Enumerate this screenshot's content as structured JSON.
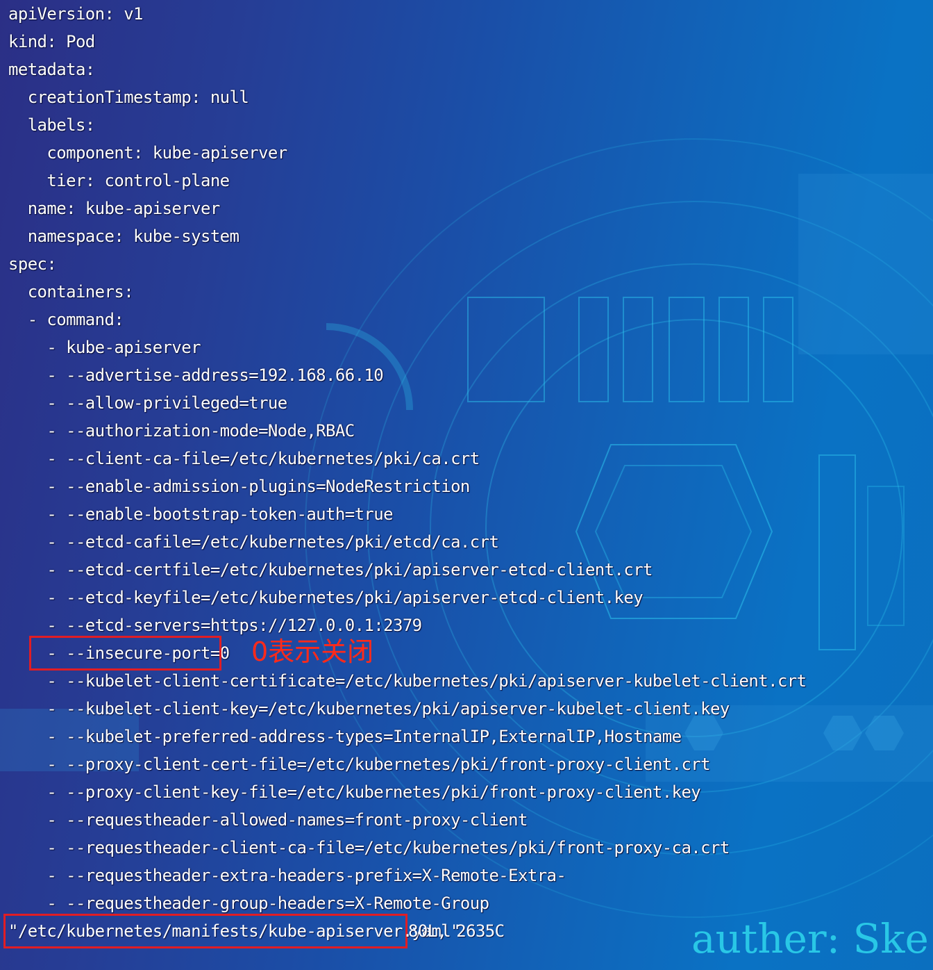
{
  "terminal": {
    "lines": [
      "apiVersion: v1",
      "kind: Pod",
      "metadata:",
      "  creationTimestamp: null",
      "  labels:",
      "    component: kube-apiserver",
      "    tier: control-plane",
      "  name: kube-apiserver",
      "  namespace: kube-system",
      "spec:",
      "  containers:",
      "  - command:",
      "    - kube-apiserver",
      "    - --advertise-address=192.168.66.10",
      "    - --allow-privileged=true",
      "    - --authorization-mode=Node,RBAC",
      "    - --client-ca-file=/etc/kubernetes/pki/ca.crt",
      "    - --enable-admission-plugins=NodeRestriction",
      "    - --enable-bootstrap-token-auth=true",
      "    - --etcd-cafile=/etc/kubernetes/pki/etcd/ca.crt",
      "    - --etcd-certfile=/etc/kubernetes/pki/apiserver-etcd-client.crt",
      "    - --etcd-keyfile=/etc/kubernetes/pki/apiserver-etcd-client.key",
      "    - --etcd-servers=https://127.0.0.1:2379",
      "    - --insecure-port=0",
      "    - --kubelet-client-certificate=/etc/kubernetes/pki/apiserver-kubelet-client.crt",
      "    - --kubelet-client-key=/etc/kubernetes/pki/apiserver-kubelet-client.key",
      "    - --kubelet-preferred-address-types=InternalIP,ExternalIP,Hostname",
      "    - --proxy-client-cert-file=/etc/kubernetes/pki/front-proxy-client.crt",
      "    - --proxy-client-key-file=/etc/kubernetes/pki/front-proxy-client.key",
      "    - --requestheader-allowed-names=front-proxy-client",
      "    - --requestheader-client-ca-file=/etc/kubernetes/pki/front-proxy-ca.crt",
      "    - --requestheader-extra-headers-prefix=X-Remote-Extra-",
      "    - --requestheader-group-headers=X-Remote-Group"
    ],
    "text_color": "#ffffff"
  },
  "annotation": {
    "text": "0表示关闭",
    "color": "#ff2a1a",
    "box_color": "#e11d24"
  },
  "status_bar": {
    "file": "\"/etc/kubernetes/manifests/kube-apiserver.yaml\"",
    "info": "80L, 2635C"
  },
  "watermark": {
    "text": "auther: Ske",
    "color": "#29c7e6"
  }
}
